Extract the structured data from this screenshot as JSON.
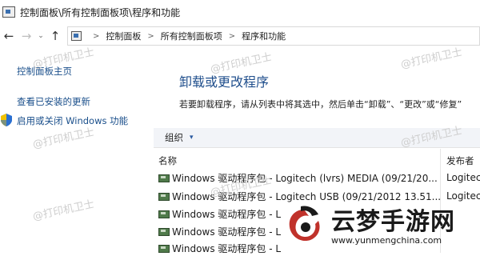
{
  "window": {
    "title": "控制面板\\所有控制面板项\\程序和功能"
  },
  "nav": {
    "back": "←",
    "forward": "→",
    "recent": "⌄",
    "up": "↑"
  },
  "address": {
    "crumbs": [
      "控制面板",
      "所有控制面板项",
      "程序和功能"
    ],
    "separator": ">"
  },
  "left_pane": {
    "home_link": "控制面板主页",
    "updates_link": "查看已安装的更新",
    "features_link": "启用或关闭 Windows 功能"
  },
  "main": {
    "heading": "卸载或更改程序",
    "description": "若要卸载程序，请从列表中将其选中，然后单击“卸载”、“更改”或“修复”",
    "toolbar": {
      "organize": "组织",
      "caret": "▾"
    },
    "columns": {
      "name": "名称",
      "publisher": "发布者"
    },
    "rows": [
      {
        "name": "Windows 驱动程序包 - Logitech (lvrs) MEDIA  (09/21/20...",
        "publisher": "Logitec"
      },
      {
        "name": "Windows 驱动程序包 - Logitech USB  (09/21/2012 13.51...",
        "publisher": "Logitec"
      },
      {
        "name": "Windows 驱动程序包 - L",
        "publisher": ""
      },
      {
        "name": "Windows 驱动程序包 - L",
        "publisher": ""
      },
      {
        "name": "Windows 驱动程序包 - L",
        "publisher": ""
      }
    ]
  },
  "watermarks": {
    "text": "@打印机卫士"
  },
  "brand": {
    "name": "云梦手游网",
    "url": "www.yunmengchina.com"
  },
  "colors": {
    "link": "#1a4f8b",
    "heading": "#1f4e8c",
    "toolbar_bg": "#f2f4f8",
    "brand_red": "#c0322b"
  }
}
